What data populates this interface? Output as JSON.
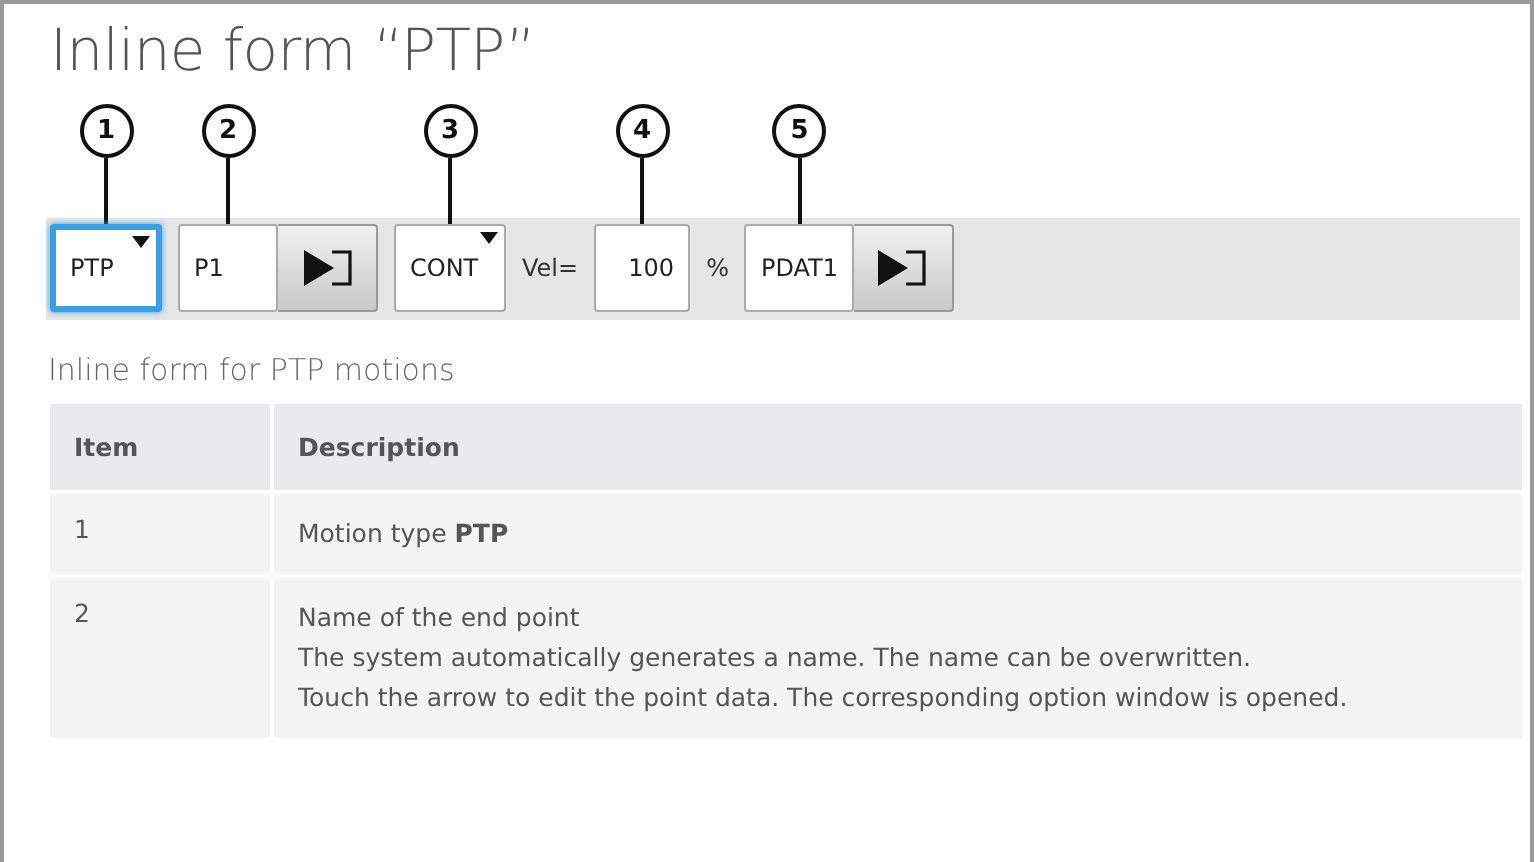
{
  "title": "Inline form “PTP”",
  "toolbar": [
    {
      "kind": "dropdown",
      "callout": "1",
      "value": "PTP",
      "selected": true
    },
    {
      "kind": "field_arrow",
      "callout": "2",
      "value": "P1",
      "selected": false
    },
    {
      "kind": "dropdown",
      "callout": "3",
      "value": "CONT",
      "selected": false
    },
    {
      "kind": "label",
      "value": "Vel="
    },
    {
      "kind": "field",
      "callout": "4",
      "value": "100",
      "selected": false
    },
    {
      "kind": "label",
      "value": "%"
    },
    {
      "kind": "field_arrow",
      "callout": "5",
      "value": "PDAT1",
      "selected": false
    }
  ],
  "caption": "Inline form for PTP motions",
  "table": {
    "columns": [
      "Item",
      "Description"
    ],
    "rows": [
      {
        "item": "1",
        "lines": [
          "Motion type **PTP**"
        ]
      },
      {
        "item": "2",
        "lines": [
          "Name of the end point",
          "The system automatically generates a name. The name can be overwritten.",
          "Touch the arrow to edit the point data. The corresponding option window is opened."
        ]
      }
    ]
  }
}
